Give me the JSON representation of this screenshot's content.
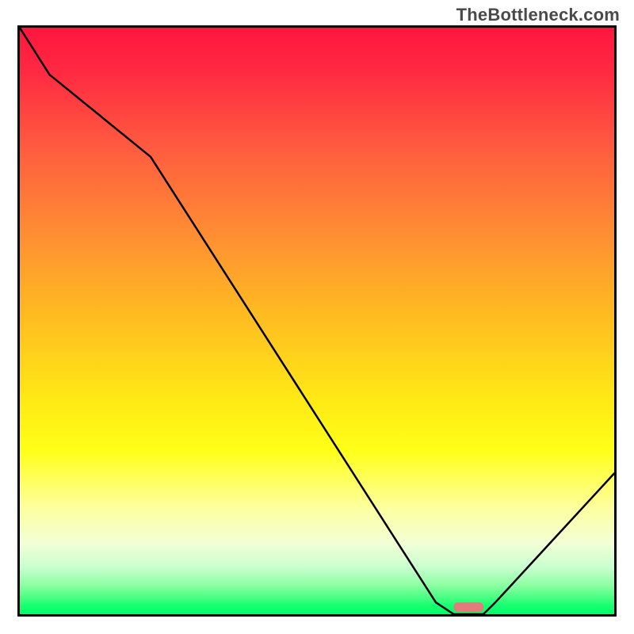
{
  "watermark": "TheBottleneck.com",
  "chart_data": {
    "type": "line",
    "x": [
      0,
      5,
      22,
      70,
      73,
      78,
      80,
      100
    ],
    "values": [
      100,
      92,
      78,
      2,
      0,
      0,
      2,
      24
    ],
    "title": "",
    "xlabel": "",
    "ylabel": "",
    "xlim": [
      0,
      100
    ],
    "ylim": [
      0,
      100
    ],
    "marker": {
      "x_start": 73,
      "x_end": 78,
      "y": 1.2,
      "color": "#e27b7b"
    }
  }
}
